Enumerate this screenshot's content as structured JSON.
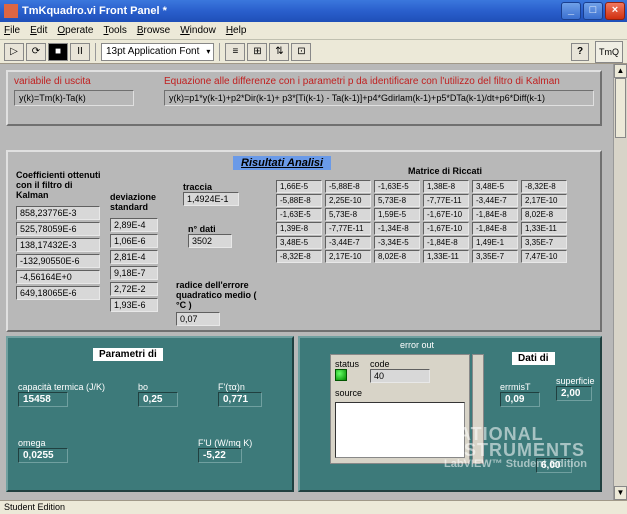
{
  "window": {
    "title": "TmKquadro.vi Front Panel *",
    "min": "_",
    "max": "□",
    "close": "×"
  },
  "menu": {
    "file": "File",
    "edit": "Edit",
    "operate": "Operate",
    "tools": "Tools",
    "browse": "Browse",
    "window": "Window",
    "help": "Help"
  },
  "toolbar": {
    "run": "▷",
    "cont": "⟳",
    "stop": "■",
    "pause": "II",
    "font": "13pt Application Font",
    "help": "?",
    "pane": "TmQ"
  },
  "equation": {
    "var_label": "variabile di uscita",
    "var_eq": "y(k)=Tm(k)-Ta(k)",
    "eq_label": "Equazione alle differenze con i parametri p da identificare con l'utilizzo del filtro di Kalman",
    "eq_expr": "y(k)=p1*y(k-1)+p2*Dir(k-1)+ p3*[Ti(k-1) - Ta(k-1)]+p4*Gdirlam(k-1)+p5*DTa(k-1)/dt+p6*Diff(k-1)"
  },
  "kalman": {
    "title": "Coefficienti ottenuti con il filtro di Kalman",
    "col1": [
      "858,23776E-3",
      "525,78059E-6",
      "138,17432E-3",
      "-132,90550E-6",
      "-4,56164E+0",
      "649,18065E-6"
    ],
    "dev_label": "deviazione standard",
    "col2": [
      "2,89E-4",
      "1,06E-6",
      "2,81E-4",
      "9,18E-7",
      "2,72E-2",
      "1,93E-6"
    ]
  },
  "analisi": {
    "title": "Risultati Analisi",
    "traccia_label": "traccia",
    "traccia": "1,4924E-1",
    "ndati_label": "n° dati",
    "ndati": "3502",
    "rmse_label": "radice dell'errore quadratico medio ( °C )",
    "rmse": "0,07"
  },
  "riccati": {
    "title": "Matrice di Riccati",
    "rows": [
      [
        "1,66E-5",
        "-5,88E-8",
        "-1,63E-5",
        "1,38E-8",
        "3,48E-5",
        "-8,32E-8"
      ],
      [
        "-5,88E-8",
        "2,25E-10",
        "5,73E-8",
        "-7,77E-11",
        "-3,44E-7",
        "2,17E-10"
      ],
      [
        "-1,63E-5",
        "5,73E-8",
        "1,59E-5",
        "-1,67E-10",
        "-1,84E-8",
        "8,02E-8"
      ],
      [
        "1,39E-8",
        "-7,77E-11",
        "-1,34E-8",
        "-1,67E-10",
        "-1,84E-8",
        "1,33E-11"
      ],
      [
        "3,48E-5",
        "-3,44E-7",
        "-3,34E-5",
        "-1,84E-8",
        "1,49E-1",
        "3,35E-7"
      ],
      [
        "-8,32E-8",
        "2,17E-10",
        "8,02E-8",
        "1,33E-11",
        "3,35E-7",
        "7,47E-10"
      ]
    ]
  },
  "param": {
    "title": "Parametri di",
    "cap_label": "capacità termica (J/K)",
    "cap": "15458",
    "bo_label": "bo",
    "bo": "0,25",
    "ftan_label": "F'(τα)n",
    "ftan": "0,771",
    "omega_label": "omega",
    "omega": "0,0255",
    "fu_label": "F'U (W/mq K)",
    "fu": "-5,22"
  },
  "error": {
    "title": "error out",
    "status": "status",
    "code": "code",
    "codeval": "40",
    "source": "source"
  },
  "dati": {
    "title": "Dati di",
    "errmisT_label": "errmisT",
    "errmisT": "0,09",
    "sup_label": "superficie",
    "sup": "2,00",
    "extra": "6,00"
  },
  "status": "Student Edition"
}
